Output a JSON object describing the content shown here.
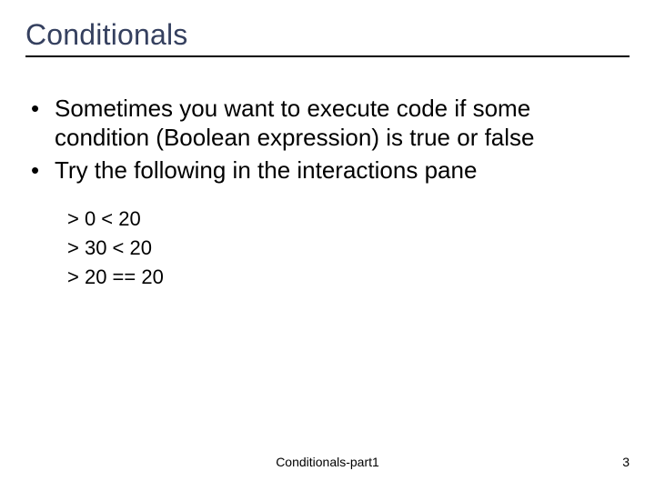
{
  "title": "Conditionals",
  "bullets": [
    "Sometimes you want to execute code if some condition (Boolean expression) is true or false",
    "Try the following in the interactions pane"
  ],
  "code": [
    "> 0 < 20",
    "> 30 < 20",
    "> 20 == 20"
  ],
  "footer": "Conditionals-part1",
  "page": "3"
}
